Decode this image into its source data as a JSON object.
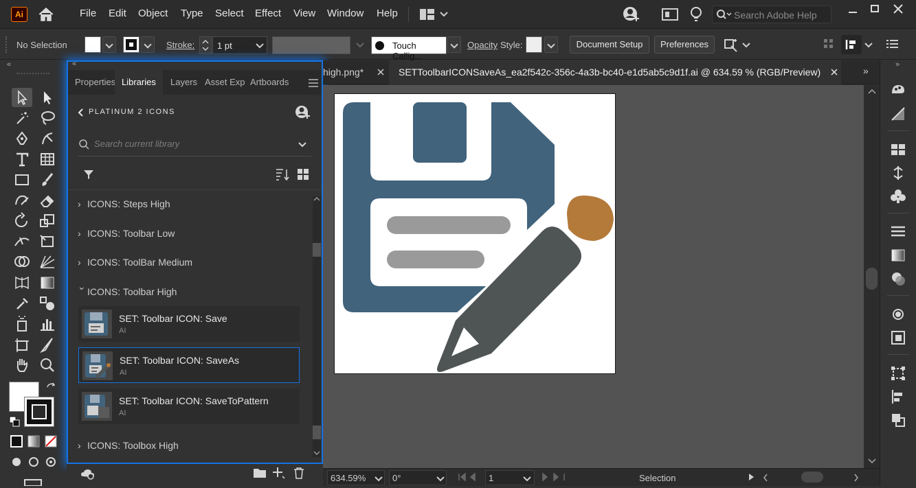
{
  "app": {
    "logo": "Ai"
  },
  "menu": {
    "items": [
      "File",
      "Edit",
      "Object",
      "Type",
      "Select",
      "Effect",
      "View",
      "Window",
      "Help"
    ],
    "search_placeholder": "Search Adobe Help"
  },
  "control_bar": {
    "selection_label": "No Selection",
    "stroke_label": "Stroke:",
    "stroke_value": "1 pt",
    "brush_label": "Touch Callig...",
    "opacity_label": "Opacity",
    "style_label": "Style:",
    "document_setup": "Document Setup",
    "preferences": "Preferences"
  },
  "libraries_panel": {
    "tabs": [
      "Properties",
      "Libraries",
      "Layers",
      "Asset Export",
      "Artboards"
    ],
    "active_tab": "Libraries",
    "library_name": "PLATINUM 2 ICONS",
    "search_placeholder": "Search current library",
    "groups_above": [
      "ICONS: Steps High",
      "ICONS: Toolbar Low",
      "ICONS: ToolBar Medium"
    ],
    "expanded_group": "ICONS: Toolbar High",
    "assets": [
      {
        "title": "SET: Toolbar ICON: Save",
        "type": "AI"
      },
      {
        "title": "SET: Toolbar ICON: SaveAs",
        "type": "AI"
      },
      {
        "title": "SET: Toolbar ICON: SaveToPattern",
        "type": "AI"
      }
    ],
    "group_below": "ICONS: Toolbox High"
  },
  "document": {
    "tab_partial": "high.png*",
    "tab_active": "SETToolbarICONSaveAs_ea2f542c-356c-4a3b-bc40-e1d5ab5c9d1f.ai @ 634.59 % (RGB/Preview)"
  },
  "status_bar": {
    "zoom": "634.59%",
    "rotation": "0°",
    "artboard": "1",
    "tool": "Selection"
  },
  "colors": {
    "accent": "#1473e6",
    "floppy_blue": "#41637c",
    "pencil_gray": "#4f5455",
    "eraser_orange": "#b47a3a",
    "label_gray": "#9a9a9a"
  }
}
